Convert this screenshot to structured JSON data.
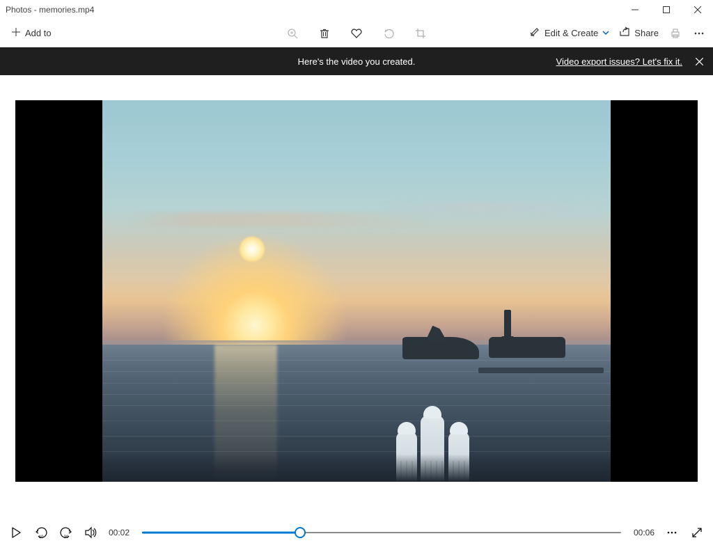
{
  "window": {
    "title": "Photos - memories.mp4"
  },
  "toolbar": {
    "add_to_label": "Add to",
    "edit_create_label": "Edit & Create",
    "share_label": "Share"
  },
  "banner": {
    "message": "Here's the video you created.",
    "link_label": "Video export issues? Let's fix it."
  },
  "playback": {
    "current_time": "00:02",
    "total_time": "00:06",
    "progress_percent": 33
  }
}
